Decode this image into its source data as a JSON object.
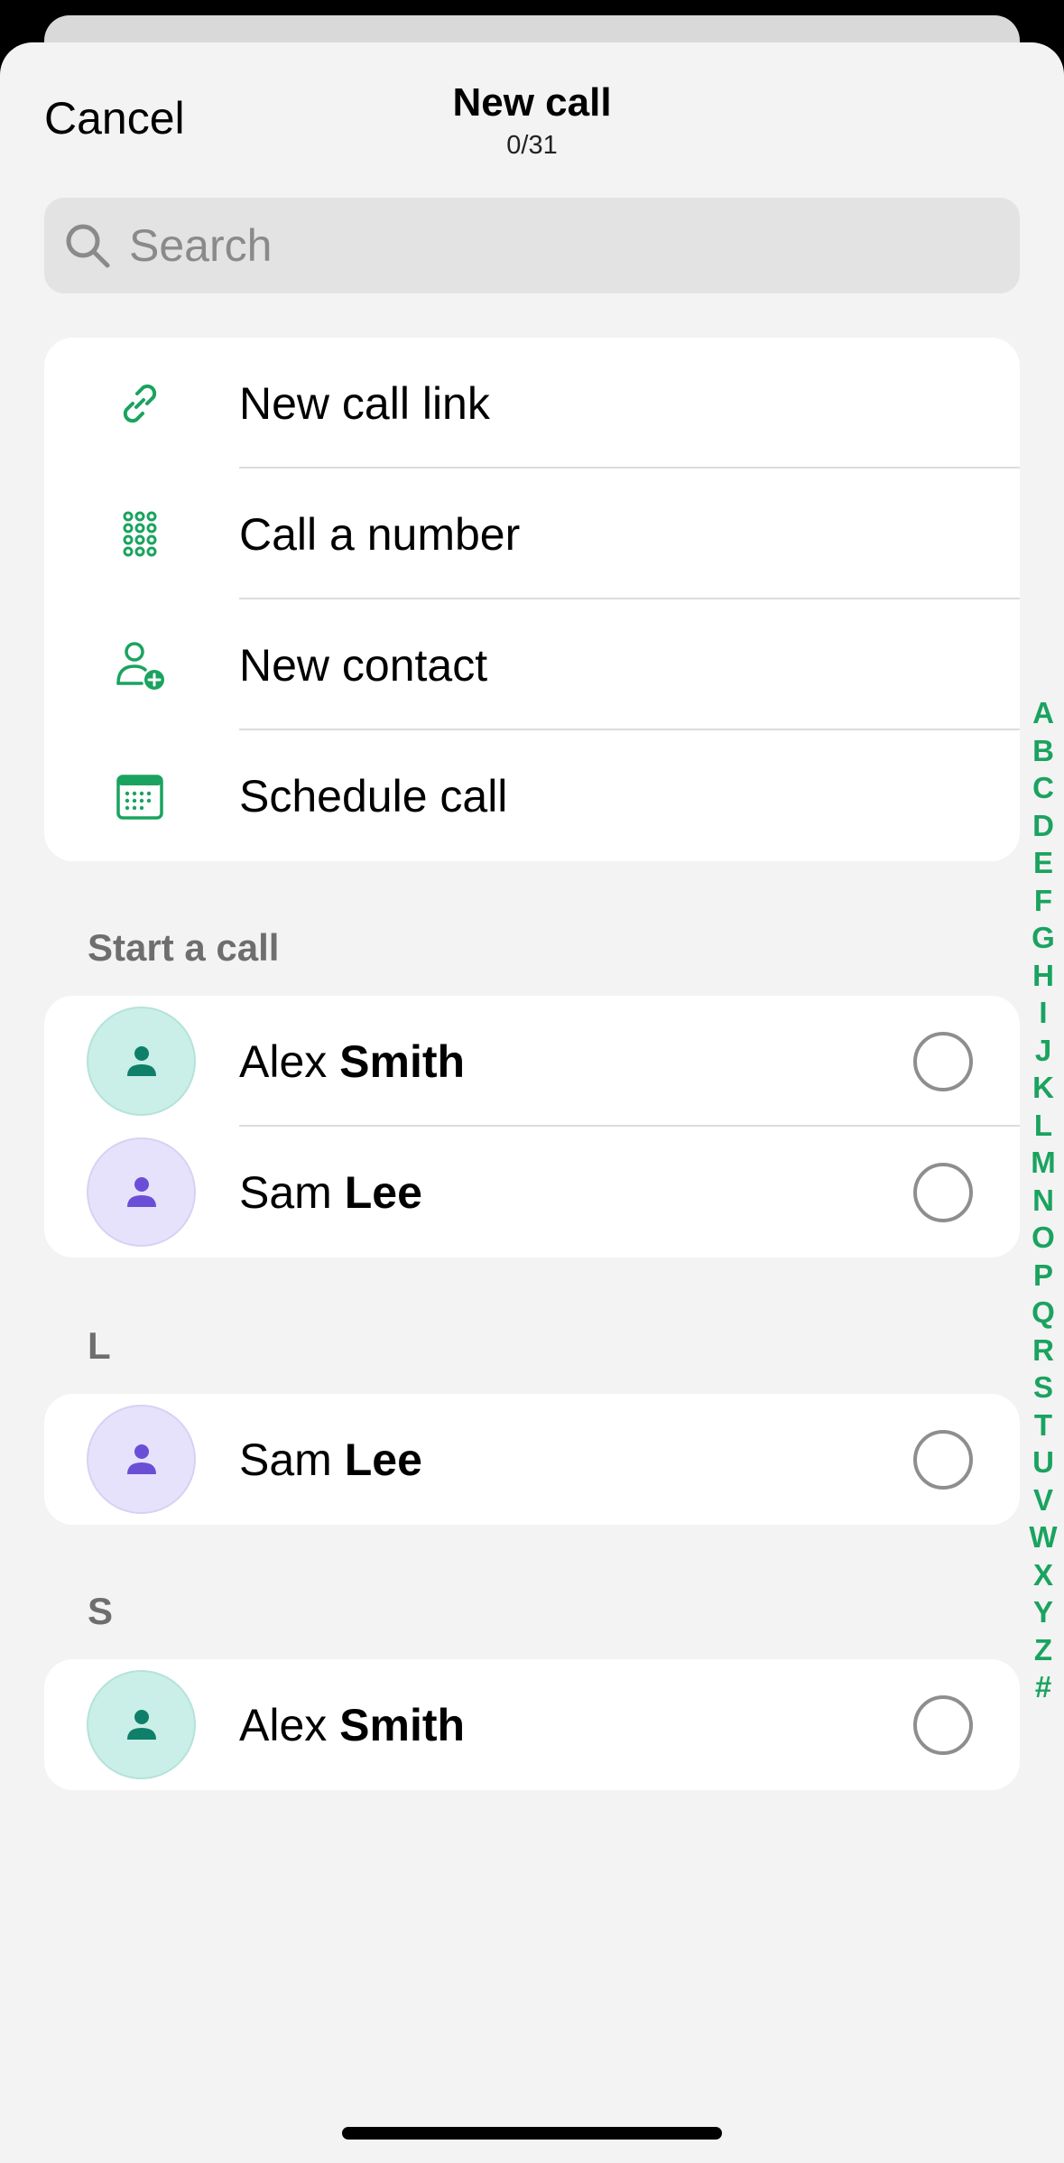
{
  "header": {
    "cancel_label": "Cancel",
    "title": "New call",
    "subtitle": "0/31"
  },
  "search": {
    "placeholder": "Search",
    "value": ""
  },
  "menu": [
    {
      "label": "New call link",
      "icon": "link-icon"
    },
    {
      "label": "Call a number",
      "icon": "dialpad-icon"
    },
    {
      "label": "New contact",
      "icon": "add-contact-icon"
    },
    {
      "label": "Schedule call",
      "icon": "calendar-icon"
    }
  ],
  "sections": [
    {
      "title": "Start a call",
      "contacts": [
        {
          "first": "Alex",
          "last": "Smith",
          "avatar_color": "#c9efe8",
          "icon_color": "#0f7f6a",
          "selected": false
        },
        {
          "first": "Sam",
          "last": "Lee",
          "avatar_color": "#e7e2fb",
          "icon_color": "#6a4fd6",
          "selected": false
        }
      ]
    },
    {
      "title": "L",
      "contacts": [
        {
          "first": "Sam",
          "last": "Lee",
          "avatar_color": "#e7e2fb",
          "icon_color": "#6a4fd6",
          "selected": false
        }
      ]
    },
    {
      "title": "S",
      "contacts": [
        {
          "first": "Alex",
          "last": "Smith",
          "avatar_color": "#c9efe8",
          "icon_color": "#0f7f6a",
          "selected": false
        }
      ]
    }
  ],
  "alphabet_index": [
    "A",
    "B",
    "C",
    "D",
    "E",
    "F",
    "G",
    "H",
    "I",
    "J",
    "K",
    "L",
    "M",
    "N",
    "O",
    "P",
    "Q",
    "R",
    "S",
    "T",
    "U",
    "V",
    "W",
    "X",
    "Y",
    "Z",
    "#"
  ],
  "colors": {
    "accent": "#1aa35f",
    "teal_icon": "#0f7f6a",
    "purple_icon": "#6a4fd6"
  }
}
